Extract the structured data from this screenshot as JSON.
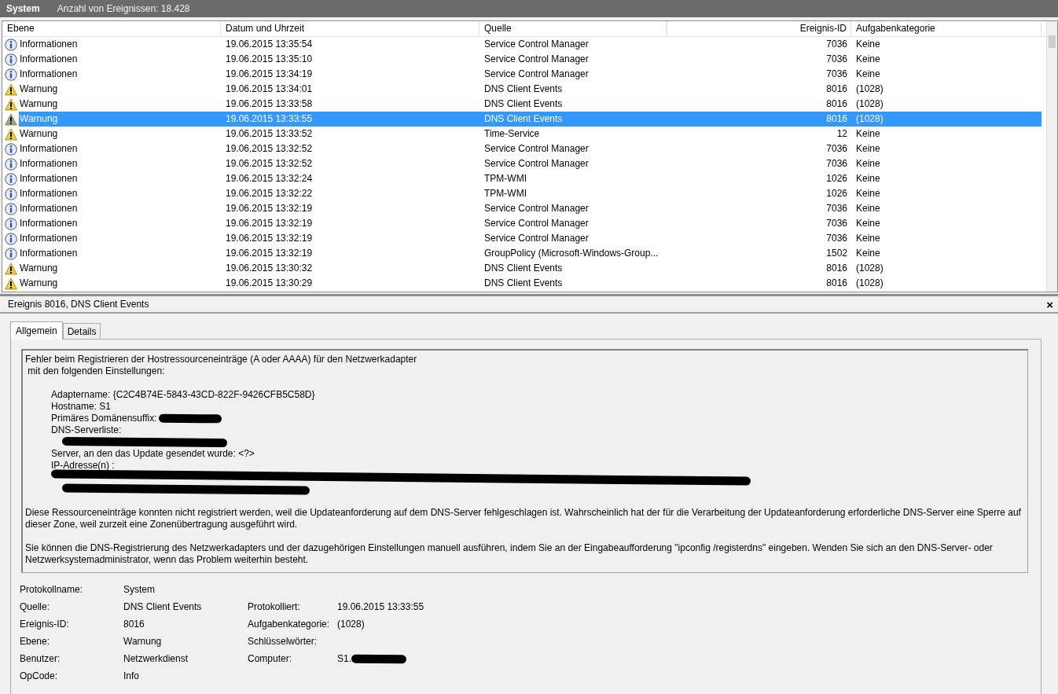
{
  "title_bar": {
    "title": "System",
    "count": "Anzahl von Ereignissen: 18.428"
  },
  "table": {
    "columns": [
      {
        "label": "Ebene"
      },
      {
        "label": "Datum und Uhrzeit"
      },
      {
        "label": "Quelle"
      },
      {
        "label": "Ereignis-ID"
      },
      {
        "label": "Aufgabenkategorie"
      }
    ],
    "rows": [
      {
        "kind": "info",
        "level": "Informationen",
        "date": "19.06.2015 13:35:54",
        "source": "Service Control Manager",
        "id": "7036",
        "category": "Keine",
        "selected": false
      },
      {
        "kind": "info",
        "level": "Informationen",
        "date": "19.06.2015 13:35:10",
        "source": "Service Control Manager",
        "id": "7036",
        "category": "Keine",
        "selected": false
      },
      {
        "kind": "info",
        "level": "Informationen",
        "date": "19.06.2015 13:34:19",
        "source": "Service Control Manager",
        "id": "7036",
        "category": "Keine",
        "selected": false
      },
      {
        "kind": "warning",
        "level": "Warnung",
        "date": "19.06.2015 13:34:01",
        "source": "DNS Client Events",
        "id": "8016",
        "category": "(1028)",
        "selected": false
      },
      {
        "kind": "warning",
        "level": "Warnung",
        "date": "19.06.2015 13:33:58",
        "source": "DNS Client Events",
        "id": "8016",
        "category": "(1028)",
        "selected": false
      },
      {
        "kind": "warning",
        "level": "Warnung",
        "date": "19.06.2015 13:33:55",
        "source": "DNS Client Events",
        "id": "8016",
        "category": "(1028)",
        "selected": true
      },
      {
        "kind": "warning",
        "level": "Warnung",
        "date": "19.06.2015 13:33:52",
        "source": "Time-Service",
        "id": "12",
        "category": "Keine",
        "selected": false
      },
      {
        "kind": "info",
        "level": "Informationen",
        "date": "19.06.2015 13:32:52",
        "source": "Service Control Manager",
        "id": "7036",
        "category": "Keine",
        "selected": false
      },
      {
        "kind": "info",
        "level": "Informationen",
        "date": "19.06.2015 13:32:52",
        "source": "Service Control Manager",
        "id": "7036",
        "category": "Keine",
        "selected": false
      },
      {
        "kind": "info",
        "level": "Informationen",
        "date": "19.06.2015 13:32:24",
        "source": "TPM-WMI",
        "id": "1026",
        "category": "Keine",
        "selected": false
      },
      {
        "kind": "info",
        "level": "Informationen",
        "date": "19.06.2015 13:32:22",
        "source": "TPM-WMI",
        "id": "1026",
        "category": "Keine",
        "selected": false
      },
      {
        "kind": "info",
        "level": "Informationen",
        "date": "19.06.2015 13:32:19",
        "source": "Service Control Manager",
        "id": "7036",
        "category": "Keine",
        "selected": false
      },
      {
        "kind": "info",
        "level": "Informationen",
        "date": "19.06.2015 13:32:19",
        "source": "Service Control Manager",
        "id": "7036",
        "category": "Keine",
        "selected": false
      },
      {
        "kind": "info",
        "level": "Informationen",
        "date": "19.06.2015 13:32:19",
        "source": "Service Control Manager",
        "id": "7036",
        "category": "Keine",
        "selected": false
      },
      {
        "kind": "info",
        "level": "Informationen",
        "date": "19.06.2015 13:32:19",
        "source": "GroupPolicy (Microsoft-Windows-Group...",
        "id": "1502",
        "category": "Keine",
        "selected": false
      },
      {
        "kind": "warning",
        "level": "Warnung",
        "date": "19.06.2015 13:30:32",
        "source": "DNS Client Events",
        "id": "8016",
        "category": "(1028)",
        "selected": false
      },
      {
        "kind": "warning",
        "level": "Warnung",
        "date": "19.06.2015 13:30:29",
        "source": "DNS Client Events",
        "id": "8016",
        "category": "(1028)",
        "selected": false
      }
    ]
  },
  "detail": {
    "title": "Ereignis 8016, DNS Client Events",
    "close": "×",
    "tabs": [
      {
        "label": "Allgemein",
        "selected": true
      },
      {
        "label": "Details",
        "selected": false
      }
    ],
    "message": {
      "intro": [
        "Fehler beim Registrieren der Hostressourceneinträge (A oder AAAA) für den Netzwerkadapter",
        " mit den folgenden Einstellungen:"
      ],
      "settings": [
        {
          "kind": "text",
          "text": "Adaptername: {C2C4B74E-5843-43CD-822F-9426CFB5C58D}",
          "redacted": false
        },
        {
          "kind": "text",
          "text": "Hostname: S1",
          "redacted": false
        },
        {
          "kind": "text",
          "text": "Primäres Domänensuffix:",
          "redacted": true
        },
        {
          "kind": "text",
          "text": "DNS-Serverliste:",
          "redacted": false
        },
        {
          "kind": "redacted-short"
        },
        {
          "kind": "text",
          "text": "Server, an den das Update gesendet wurde: <?>",
          "redacted": false
        },
        {
          "kind": "text",
          "text": "IP-Adresse(n) :",
          "redacted": false
        },
        {
          "kind": "redacted-long"
        },
        {
          "kind": "redacted-mid"
        }
      ],
      "paragraphs": [
        "Diese Ressourceneinträge konnten nicht registriert werden, weil die Updateanforderung auf dem DNS-Server fehlgeschlagen ist. Wahrscheinlich hat der für die Verarbeitung der Updateanforderung erforderliche DNS-Server eine Sperre auf dieser Zone, weil zurzeit eine Zonenübertragung ausgeführt wird.",
        "Sie können die DNS-Registrierung des Netzwerkadapters und der dazugehörigen Einstellungen manuell ausführen, indem Sie an der Eingabeaufforderung \"ipconfig /registerdns\" eingeben. Wenden Sie sich an den DNS-Server- oder Netzwerksystemadministrator, wenn das Problem weiterhin besteht."
      ]
    },
    "properties": [
      {
        "label": "Protokollname:",
        "value": "System"
      },
      {
        "label": "Quelle:",
        "value": "DNS Client Events",
        "label2": "Protokolliert:",
        "value2": "19.06.2015 13:33:55",
        "redacted2": false
      },
      {
        "label": "Ereignis-ID:",
        "value": "8016",
        "label2": "Aufgabenkategorie:",
        "value2": "(1028)",
        "redacted2": false
      },
      {
        "label": "Ebene:",
        "value": "Warnung",
        "label2": "Schlüsselwörter:",
        "redacted2": false
      },
      {
        "label": "Benutzer:",
        "value": "Netzwerkdienst",
        "label2": "Computer:",
        "value2": "S1.",
        "redacted2": true
      },
      {
        "label": "OpCode:",
        "value": "Info"
      }
    ]
  }
}
